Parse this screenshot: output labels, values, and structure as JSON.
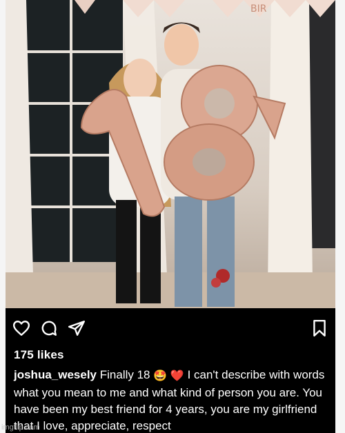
{
  "post": {
    "photo_alt": "",
    "banner_letters": "BIR",
    "actions": [
      {
        "name": "like-button",
        "icon": "heart-icon"
      },
      {
        "name": "comment-button",
        "icon": "comment-icon"
      },
      {
        "name": "share-button",
        "icon": "send-icon"
      },
      {
        "name": "save-button",
        "icon": "bookmark-icon"
      }
    ],
    "likes_text": "175 likes",
    "username": "joshua_wesely",
    "caption_start": "Finally 18",
    "emoji_1": "🤩",
    "emoji_2": "❤️",
    "caption_rest": "I can't describe with words what you mean to me and what kind of person you are. You have been my best friend for 4 years, you are my girlfriend that I love, appreciate, respect"
  },
  "watermark": "imgflip.com",
  "colors": {
    "background": "#000000",
    "text": "#ffffff",
    "balloon": "#d9a38c"
  }
}
